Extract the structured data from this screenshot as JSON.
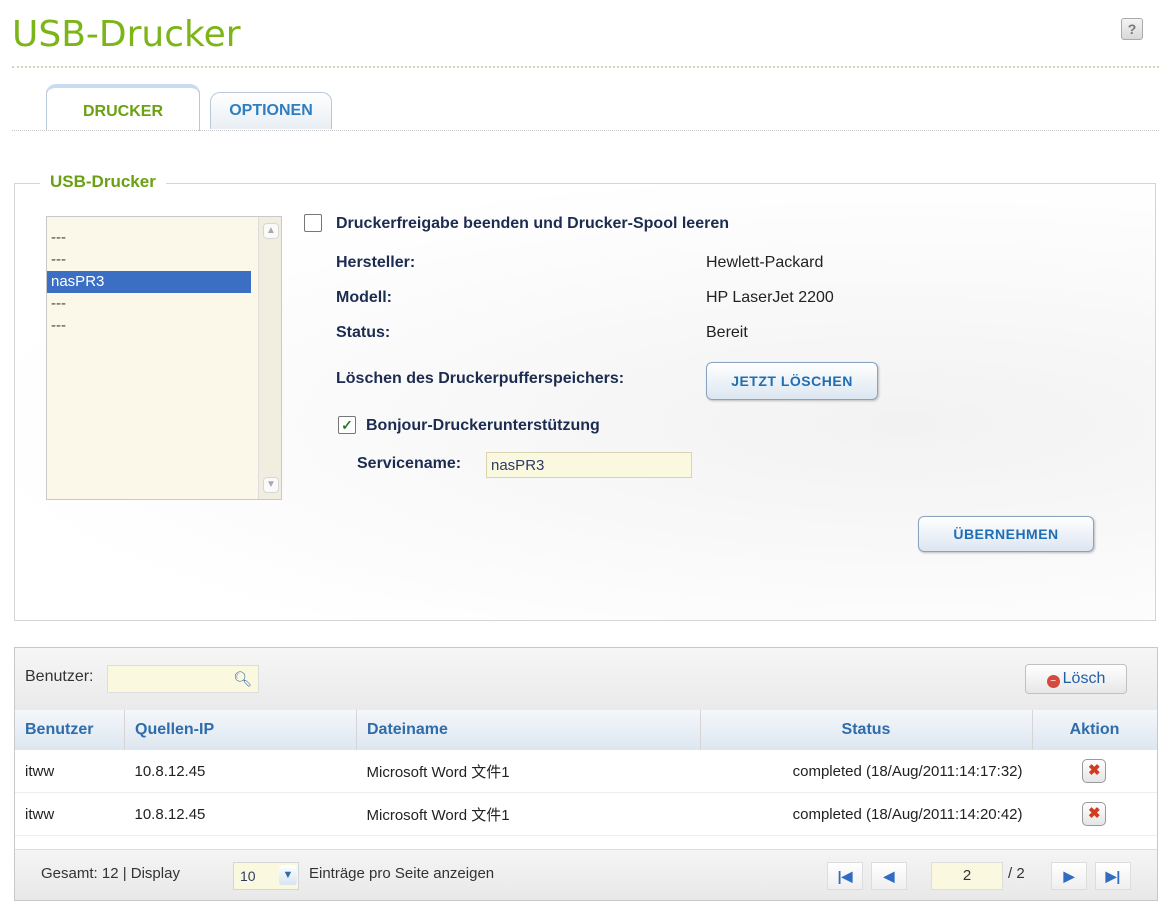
{
  "page": {
    "title": "USB-Drucker",
    "help_icon": "question-icon",
    "help_glyph": "?"
  },
  "tabs": [
    {
      "label": "DRUCKER",
      "active": true
    },
    {
      "label": "OPTIONEN",
      "active": false
    }
  ],
  "printer_section": {
    "legend": "USB-Drucker",
    "printers": [
      "---",
      "---",
      "nasPR3",
      "---",
      "---"
    ],
    "selected_printer": "nasPR3",
    "stop_sharing_label": "Druckerfreigabe beenden und Drucker-Spool leeren",
    "stop_sharing_checked": false,
    "manufacturer_label": "Hersteller:",
    "manufacturer_value": "Hewlett-Packard",
    "model_label": "Modell:",
    "model_value": "HP LaserJet 2200",
    "status_label": "Status:",
    "status_value": "Bereit",
    "clear_buffer_label": "Löschen des Druckerpufferspeichers:",
    "clear_now_button": "JETZT LÖSCHEN",
    "bonjour_label": "Bonjour-Druckerunterstützung",
    "bonjour_checked": true,
    "service_name_label": "Servicename:",
    "service_name_value": "nasPR3",
    "apply_button": "ÜBERNEHMEN"
  },
  "jobs": {
    "search_label": "Benutzer:",
    "search_value": "",
    "delete_button": "Lösch",
    "columns": [
      "Benutzer",
      "Quellen-IP",
      "Dateiname",
      "Status",
      "Aktion"
    ],
    "rows": [
      {
        "user": "itww",
        "ip": "10.8.12.45",
        "file": "Microsoft Word 文件1",
        "status": "completed (18/Aug/2011:14:17:32)"
      },
      {
        "user": "itww",
        "ip": "10.8.12.45",
        "file": "Microsoft Word 文件1",
        "status": "completed (18/Aug/2011:14:20:42)"
      }
    ],
    "footer": {
      "total_text": "Gesamt: 12 |  Display",
      "per_page": "10",
      "per_page_suffix": "Einträge pro Seite anzeigen",
      "current_page": "2",
      "total_pages": "/ 2"
    }
  },
  "colors": {
    "accent_green": "#7cb518",
    "link_blue": "#2e7fc1",
    "selection": "#3a6fc4"
  }
}
